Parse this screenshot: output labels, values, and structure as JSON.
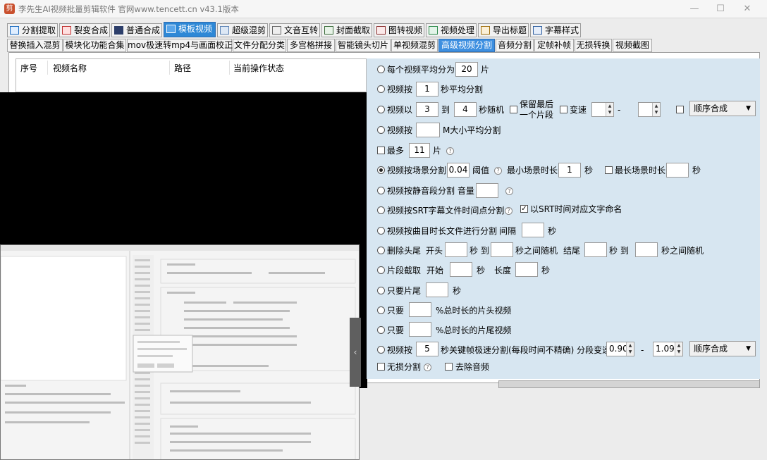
{
  "window": {
    "title": "李先生AI视频批量剪辑软件  官网www.tencett.cn  v43.1版本",
    "app_icon": "app-logo-icon"
  },
  "main_tabs": [
    {
      "label": "分割提取",
      "icon": "split-icon"
    },
    {
      "label": "裂变合成",
      "icon": "merge-icon"
    },
    {
      "label": "普通合成",
      "icon": "play-icon"
    },
    {
      "label": "模板视频",
      "icon": "template-icon",
      "active": true
    },
    {
      "label": "超级混剪",
      "icon": "waveform-icon"
    },
    {
      "label": "文音互转",
      "icon": "mic-icon"
    },
    {
      "label": "封面截取",
      "icon": "cover-icon"
    },
    {
      "label": "图转视频",
      "icon": "image-video-icon"
    },
    {
      "label": "视频处理",
      "icon": "video-process-icon"
    },
    {
      "label": "导出标题",
      "icon": "export-title-icon"
    },
    {
      "label": "字幕样式",
      "icon": "subtitle-icon"
    }
  ],
  "sub_tabs": [
    {
      "label": "替换插入混剪"
    },
    {
      "label": "模块化功能合集"
    },
    {
      "label": "mov极速转mp4与画面校正"
    },
    {
      "label": "文件分配分类"
    },
    {
      "label": "多宫格拼接"
    },
    {
      "label": "智能镜头切片"
    },
    {
      "label": "单视频混剪"
    },
    {
      "label": "高级视频分割",
      "active": true
    },
    {
      "label": "音频分割"
    },
    {
      "label": "定帧补帧"
    },
    {
      "label": "无损转换"
    },
    {
      "label": "视频截图"
    }
  ],
  "list_headers": [
    "序号",
    "视频名称",
    "路径",
    "当前操作状态"
  ],
  "options": {
    "avg_split": {
      "prefix": "每个视频平均分为",
      "value": "20",
      "suffix": "片"
    },
    "sec_split": {
      "prefix": "视频按",
      "value": "1",
      "suffix": "秒平均分割"
    },
    "random_split": {
      "prefix": "视频以",
      "from": "3",
      "to_label": "到",
      "to": "4",
      "suffix": "秒随机",
      "keep_last": "保留最后一个片段",
      "speed": "变速",
      "dash": "-",
      "order": "顺序合成"
    },
    "size_split": {
      "prefix": "视频按",
      "value": "",
      "suffix": "M大小平均分割"
    },
    "max": {
      "label": "最多",
      "value": "11",
      "suffix": "片"
    },
    "scene": {
      "label": "视频按场景分割",
      "value": "0.04",
      "threshold": "阈值",
      "min_label": "最小场景时长",
      "min_value": "1",
      "min_unit": "秒",
      "max_label": "最长场景时长",
      "max_value": "",
      "max_unit": "秒"
    },
    "silence": {
      "label": "视频按静音段分割 音量",
      "value": ""
    },
    "srt": {
      "label": "视频按SRT字幕文件时间点分割",
      "name_label": "以SRT时间对应文字命名",
      "name_checked": true
    },
    "track": {
      "label": "视频按曲目时长文件进行分割",
      "gap": "间隔",
      "value": "",
      "unit": "秒"
    },
    "trim": {
      "label": "删除头尾",
      "head": "开头",
      "sec1": "秒 到",
      "mid": "秒之间随机",
      "tail": "结尾",
      "sec3": "秒 到",
      "end": "秒之间随机"
    },
    "clip": {
      "label": "片段截取",
      "start": "开始",
      "sec": "秒",
      "len": "长度",
      "sec2": "秒"
    },
    "only_tail": {
      "label": "只要片尾",
      "unit": "秒"
    },
    "only_head_pct": {
      "label": "只要",
      "suffix": "%总时长的片头视频"
    },
    "only_tail_pct": {
      "label": "只要",
      "suffix": "%总时长的片尾视频"
    },
    "keyframe": {
      "prefix": "视频按",
      "value": "5",
      "suffix": "秒关键帧极速分割(每段时间不精确) 分段变速",
      "speed_from": "0.90",
      "dash": "-",
      "speed_to": "1.09",
      "order": "顺序合成"
    },
    "lossless": "无损分割",
    "remove_audio": "去除音频"
  },
  "selected_option": "scene",
  "colors": {
    "accent": "#2e88d6",
    "panel_bg": "#d7e6f1"
  }
}
